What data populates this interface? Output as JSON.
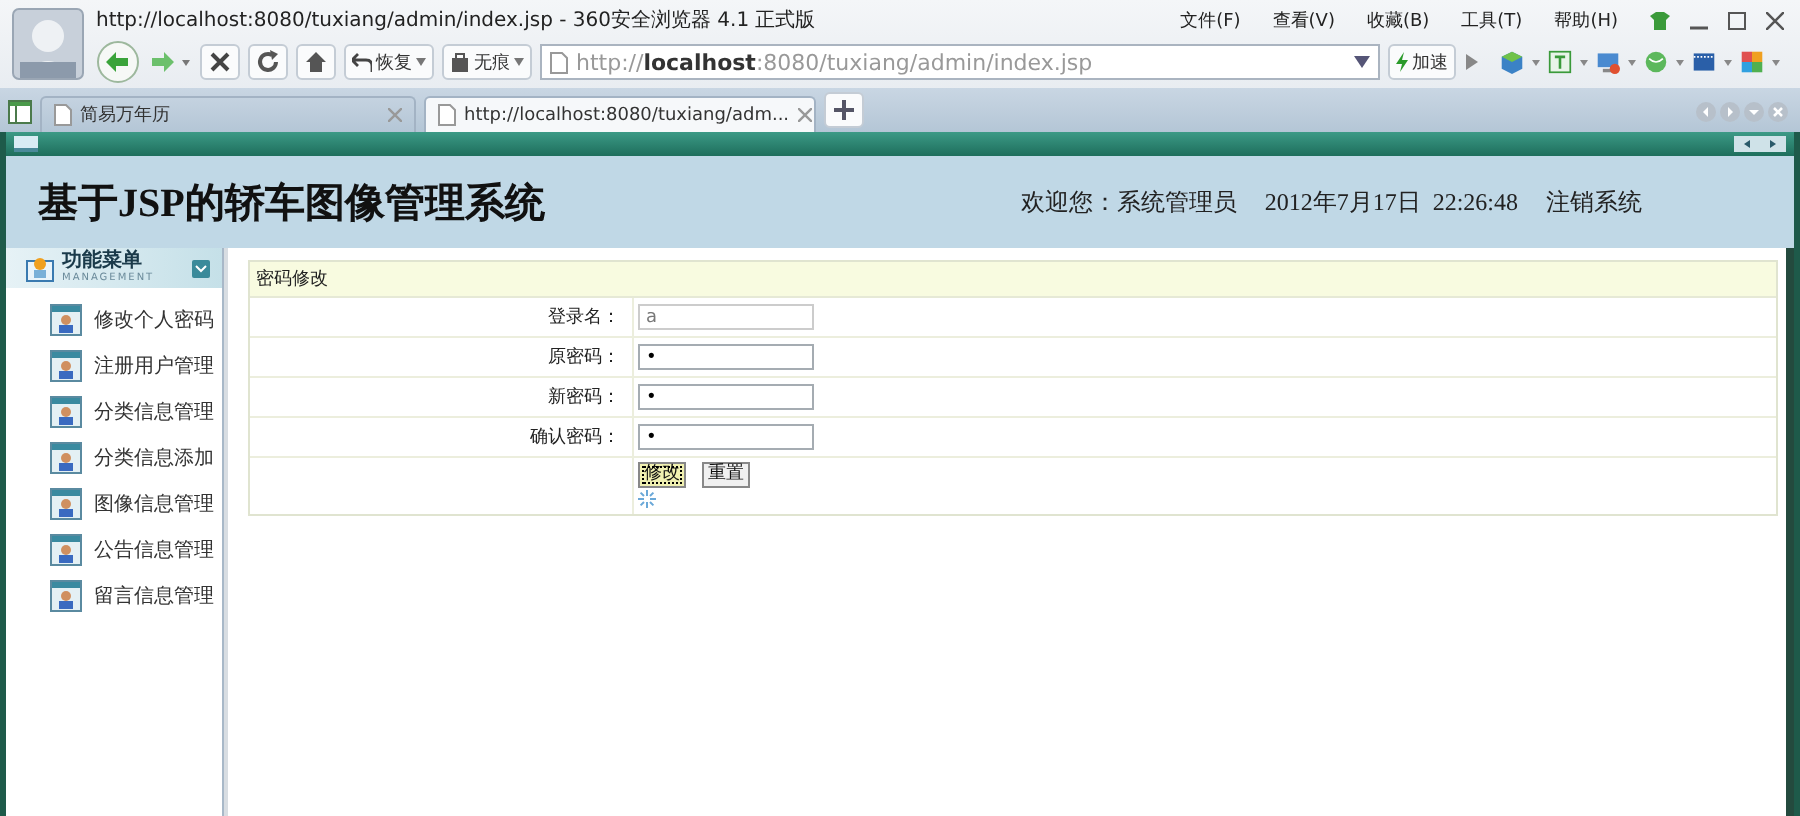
{
  "browser": {
    "title": "http://localhost:8080/tuxiang/admin/index.jsp - 360安全浏览器 4.1 正式版",
    "menu": [
      "文件(F)",
      "查看(V)",
      "收藏(B)",
      "工具(T)",
      "帮助(H)"
    ],
    "toolbar_buttons": [
      "恢复",
      "无痕"
    ],
    "address": "http://**localhost**:8080/tuxiang/admin/index.jsp",
    "speedup": "加速",
    "tabs": [
      {
        "label": "简易万年历",
        "selected": false
      },
      {
        "label": "http://localhost:8080/tuxiang/adm...",
        "selected": true
      }
    ]
  },
  "app": {
    "title": "基于JSP的轿车图像管理系统",
    "welcome": "欢迎您：系统管理员",
    "datetime": "2012年7月17日  22:26:48",
    "logout": "注销系统"
  },
  "menu": {
    "title": "功能菜单",
    "subtitle": "MANAGEMENT",
    "items": [
      {
        "label": "修改个人密码"
      },
      {
        "label": "注册用户管理"
      },
      {
        "label": "分类信息管理"
      },
      {
        "label": "分类信息添加"
      },
      {
        "label": "图像信息管理"
      },
      {
        "label": "公告信息管理"
      },
      {
        "label": "留言信息管理"
      }
    ]
  },
  "form": {
    "title": "密码修改",
    "fields": [
      {
        "label": "登录名：",
        "value": "a",
        "disabled": true
      },
      {
        "label": "原密码：",
        "value": "•",
        "disabled": false
      },
      {
        "label": "新密码：",
        "value": "•",
        "disabled": false
      },
      {
        "label": "确认密码：",
        "value": "•",
        "disabled": false
      }
    ],
    "buttons": [
      {
        "label": "修改",
        "focused": true
      },
      {
        "label": "重置",
        "focused": false
      }
    ]
  }
}
